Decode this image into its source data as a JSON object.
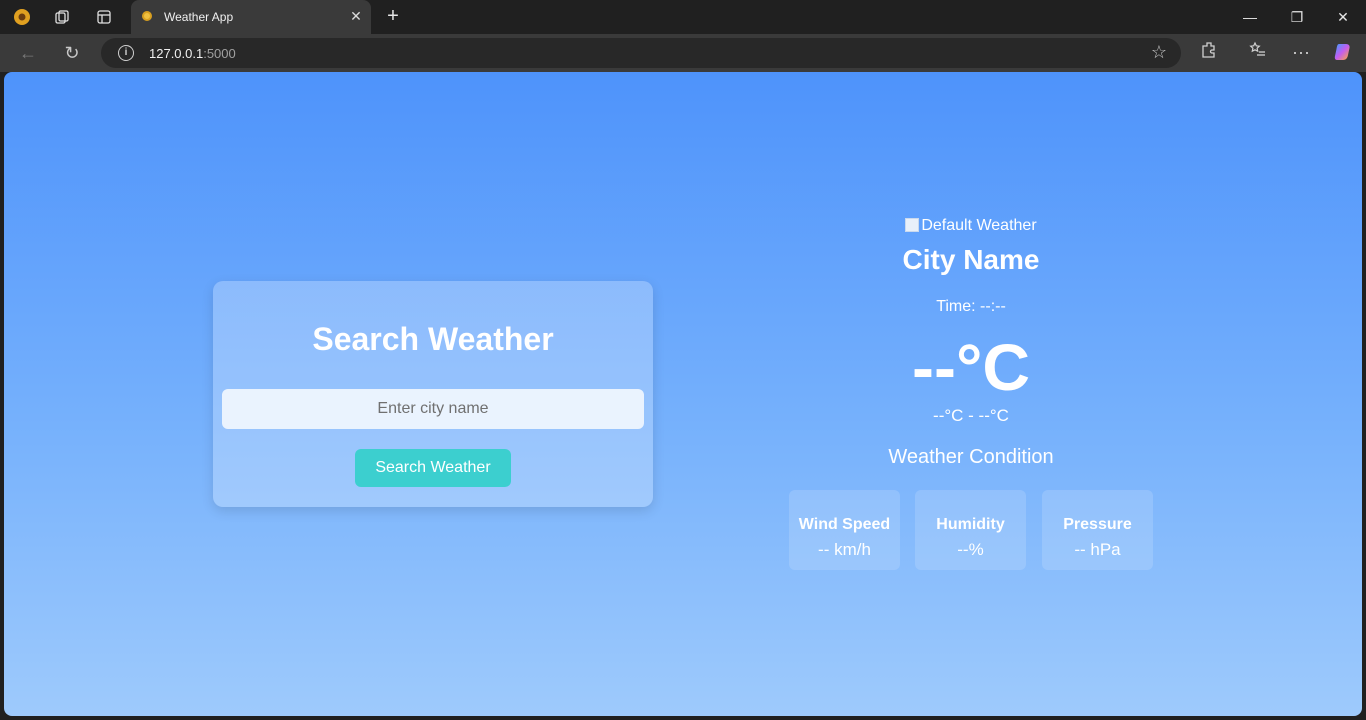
{
  "browser": {
    "tab_title": "Weather App",
    "url_host": "127.0.0.1",
    "url_port": ":5000"
  },
  "search": {
    "title": "Search Weather",
    "placeholder": "Enter city name",
    "button_label": "Search Weather"
  },
  "weather": {
    "image_alt": "Default Weather",
    "city": "City Name",
    "time": "Time: --:--",
    "temperature": "--°C",
    "range": "--°C - --°C",
    "condition": "Weather Condition",
    "stats": [
      {
        "label": "Wind Speed",
        "value": "-- km/h"
      },
      {
        "label": "Humidity",
        "value": "--%"
      },
      {
        "label": "Pressure",
        "value": "-- hPa"
      }
    ]
  },
  "colors": {
    "gradient_top": "#4e93fb",
    "gradient_bottom": "#9ecafc",
    "button": "#3ccfcf"
  }
}
